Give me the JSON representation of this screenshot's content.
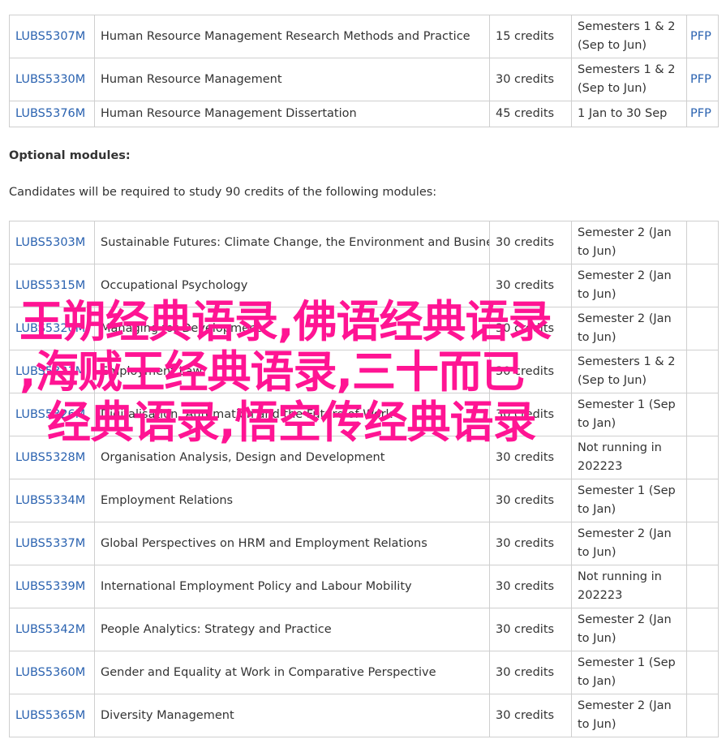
{
  "core_rows": [
    {
      "code": "LUBS5307M",
      "title": "Human Resource Management Research Methods and Practice",
      "credits": "15 credits",
      "semester": "Semesters 1 & 2 (Sep to Jun)",
      "type": "PFP"
    },
    {
      "code": "LUBS5330M",
      "title": "Human Resource Management",
      "credits": "30 credits",
      "semester": "Semesters 1 & 2 (Sep to Jun)",
      "type": "PFP"
    },
    {
      "code": "LUBS5376M",
      "title": "Human Resource Management Dissertation",
      "credits": "45 credits",
      "semester": "1 Jan to 30 Sep",
      "type": "PFP"
    }
  ],
  "optional": {
    "heading": "Optional modules:",
    "intro": "Candidates will be required to study 90 credits of the following modules:",
    "rows": [
      {
        "code": "LUBS5303M",
        "title": "Sustainable Futures: Climate Change, the Environment and Business",
        "credits": "30 credits",
        "semester": "Semester 2 (Jan to Jun)"
      },
      {
        "code": "LUBS5315M",
        "title": "Occupational Psychology",
        "credits": "30 credits",
        "semester": "Semester 2 (Jan to Jun)"
      },
      {
        "code": "LUBS5320M",
        "title": "Managing for Development",
        "credits": "30 credits",
        "semester": "Semester 2 (Jan to Jun)"
      },
      {
        "code": "LUBS5321M",
        "title": "Employment Law",
        "credits": "30 credits",
        "semester": "Semesters 1 & 2 (Sep to Jun)"
      },
      {
        "code": "LUBS5326M",
        "title": "Digitalisation, Automation and the Future of Work",
        "credits": "30 credits",
        "semester": "Semester 1 (Sep to Jan)"
      },
      {
        "code": "LUBS5328M",
        "title": "Organisation Analysis, Design and Development",
        "credits": "30 credits",
        "semester": "Not running in 202223"
      },
      {
        "code": "LUBS5334M",
        "title": "Employment Relations",
        "credits": "30 credits",
        "semester": "Semester 1 (Sep to Jan)"
      },
      {
        "code": "LUBS5337M",
        "title": "Global Perspectives on HRM and Employment Relations",
        "credits": "30 credits",
        "semester": "Semester 2 (Jan to Jun)"
      },
      {
        "code": "LUBS5339M",
        "title": "International Employment Policy and Labour Mobility",
        "credits": "30 credits",
        "semester": "Not running in 202223"
      },
      {
        "code": "LUBS5342M",
        "title": "People Analytics: Strategy and Practice",
        "credits": "30 credits",
        "semester": "Semester 2 (Jan to Jun)"
      },
      {
        "code": "LUBS5360M",
        "title": "Gender and Equality at Work in Comparative Perspective",
        "credits": "30 credits",
        "semester": "Semester 1 (Sep to Jan)"
      },
      {
        "code": "LUBS5365M",
        "title": "Diversity Management",
        "credits": "30 credits",
        "semester": "Semester 2 (Jan to Jun)"
      }
    ]
  },
  "watermark": {
    "line1": "王朔经典语录,佛语经典语录",
    "line2": ",海贼王经典语录,三十而已",
    "line3": "经典语录,悟空传经典语录"
  },
  "colors": {
    "link": "#2a62b0",
    "text": "#333333",
    "border": "#cfcfcf",
    "watermark": "#ff1493"
  }
}
